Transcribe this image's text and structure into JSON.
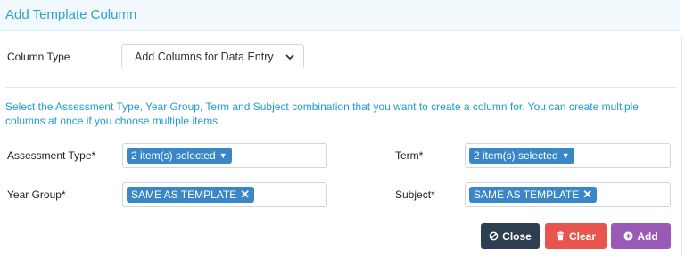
{
  "dialog": {
    "title": "Add Template Column"
  },
  "column_type": {
    "label": "Column Type",
    "value": "Add Columns for Data Entry"
  },
  "info_text": "Select the Assessment Type, Year Group, Term and Subject combination that you want to create a column for. You can create multiple columns at once if you choose multiple items",
  "fields": {
    "assessment_type": {
      "label": "Assessment Type*",
      "chip": "2 item(s) selected"
    },
    "term": {
      "label": "Term*",
      "chip": "2 item(s) selected"
    },
    "year_group": {
      "label": "Year Group*",
      "chip": "SAME AS TEMPLATE"
    },
    "subject": {
      "label": "Subject*",
      "chip": "SAME AS TEMPLATE"
    }
  },
  "buttons": {
    "close": "Close",
    "clear": "Clear",
    "add": "Add"
  },
  "icons": {
    "chip_multi": "caret-down-icon",
    "chip_remove": "close-x-icon",
    "close": "ban-icon",
    "clear": "trash-icon",
    "add": "plus-circle-icon",
    "select": "chevron-down-icon"
  },
  "colors": {
    "accent": "#2f9fd0",
    "chip": "#3a87c8",
    "close_button": "#2c3e50",
    "clear_button": "#e8554e",
    "add_button": "#9b59b6"
  }
}
